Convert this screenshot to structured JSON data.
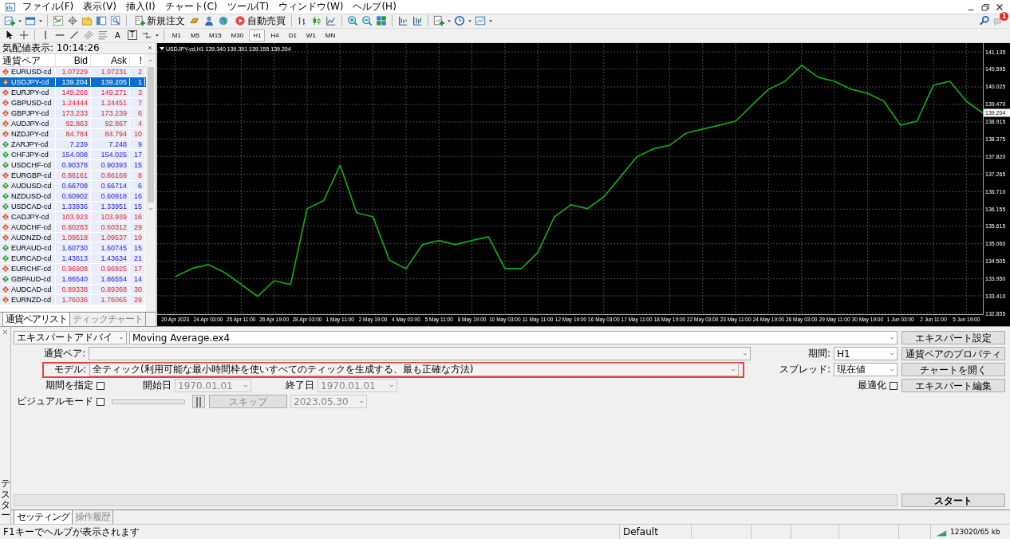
{
  "menu": [
    "ファイル(F)",
    "表示(V)",
    "挿入(I)",
    "チャート(C)",
    "ツール(T)",
    "ウィンドウ(W)",
    "ヘルプ(H)"
  ],
  "toolbar": {
    "buttons": [
      "新規注文",
      "自動売買"
    ],
    "drawing_tools": [
      "A",
      "T"
    ],
    "timeframes": [
      {
        "label": "M1",
        "selected": false
      },
      {
        "label": "M5",
        "selected": false
      },
      {
        "label": "M15",
        "selected": false
      },
      {
        "label": "M30",
        "selected": false
      },
      {
        "label": "H1",
        "selected": true
      },
      {
        "label": "H4",
        "selected": false
      },
      {
        "label": "D1",
        "selected": false
      },
      {
        "label": "W1",
        "selected": false
      },
      {
        "label": "MN",
        "selected": false
      }
    ],
    "notifications_badge": "1"
  },
  "market_watch": {
    "title": "気配値表示: 10:14:26",
    "columns": [
      "通貨ペア",
      "Bid",
      "Ask",
      "!"
    ],
    "rows": [
      {
        "symbol": "EURUSD-cd",
        "bid": "1.07229",
        "ask": "1.07231",
        "spread": "2",
        "down": true,
        "selected": false
      },
      {
        "symbol": "USDJPY-cd",
        "bid": "139.204",
        "ask": "139.205",
        "spread": "1",
        "down": true,
        "selected": true
      },
      {
        "symbol": "EURJPY-cd",
        "bid": "149.268",
        "ask": "149.271",
        "spread": "3",
        "down": true,
        "selected": false
      },
      {
        "symbol": "GBPUSD-cd",
        "bid": "1.24444",
        "ask": "1.24451",
        "spread": "7",
        "down": true,
        "selected": false
      },
      {
        "symbol": "GBPJPY-cd",
        "bid": "173.233",
        "ask": "173.239",
        "spread": "6",
        "down": true,
        "selected": false
      },
      {
        "symbol": "AUDJPY-cd",
        "bid": "92.863",
        "ask": "92.867",
        "spread": "4",
        "down": true,
        "selected": false
      },
      {
        "symbol": "NZDJPY-cd",
        "bid": "84.784",
        "ask": "84.794",
        "spread": "10",
        "down": true,
        "selected": false
      },
      {
        "symbol": "ZARJPY-cd",
        "bid": "7.239",
        "ask": "7.248",
        "spread": "9",
        "down": false,
        "selected": false
      },
      {
        "symbol": "CHFJPY-cd",
        "bid": "154.008",
        "ask": "154.025",
        "spread": "17",
        "down": false,
        "selected": false
      },
      {
        "symbol": "USDCHF-cd",
        "bid": "0.90378",
        "ask": "0.90393",
        "spread": "15",
        "down": false,
        "selected": false
      },
      {
        "symbol": "EURGBP-cd",
        "bid": "0.86161",
        "ask": "0.86169",
        "spread": "8",
        "down": true,
        "selected": false
      },
      {
        "symbol": "AUDUSD-cd",
        "bid": "0.66708",
        "ask": "0.66714",
        "spread": "6",
        "down": false,
        "selected": false
      },
      {
        "symbol": "NZDUSD-cd",
        "bid": "0.60902",
        "ask": "0.60918",
        "spread": "16",
        "down": false,
        "selected": false
      },
      {
        "symbol": "USDCAD-cd",
        "bid": "1.33936",
        "ask": "1.33951",
        "spread": "15",
        "down": false,
        "selected": false
      },
      {
        "symbol": "CADJPY-cd",
        "bid": "103.923",
        "ask": "103.939",
        "spread": "16",
        "down": true,
        "selected": false
      },
      {
        "symbol": "AUDCHF-cd",
        "bid": "0.60283",
        "ask": "0.60312",
        "spread": "29",
        "down": true,
        "selected": false
      },
      {
        "symbol": "AUDNZD-cd",
        "bid": "1.09518",
        "ask": "1.09537",
        "spread": "19",
        "down": true,
        "selected": false
      },
      {
        "symbol": "EURAUD-cd",
        "bid": "1.60730",
        "ask": "1.60745",
        "spread": "15",
        "down": false,
        "selected": false
      },
      {
        "symbol": "EURCAD-cd",
        "bid": "1.43613",
        "ask": "1.43634",
        "spread": "21",
        "down": false,
        "selected": false
      },
      {
        "symbol": "EURCHF-cd",
        "bid": "0.96908",
        "ask": "0.96925",
        "spread": "17",
        "down": true,
        "selected": false
      },
      {
        "symbol": "GBPAUD-cd",
        "bid": "1.86540",
        "ask": "1.86554",
        "spread": "14",
        "down": false,
        "selected": false
      },
      {
        "symbol": "AUDCAD-cd",
        "bid": "0.89338",
        "ask": "0.89368",
        "spread": "30",
        "down": true,
        "selected": false
      },
      {
        "symbol": "EURNZD-cd",
        "bid": "1.76036",
        "ask": "1.76065",
        "spread": "29",
        "down": true,
        "selected": false
      }
    ],
    "tabs": [
      {
        "label": "通貨ペアリスト",
        "selected": true
      },
      {
        "label": "ティックチャート",
        "selected": false
      }
    ]
  },
  "chart": {
    "header": "USDJPY-cd,H1  139.340 139.391 139.155 139.204",
    "price_marker": "139.204",
    "chart_data": {
      "type": "line",
      "categories": [
        "20 Apr 2023",
        null,
        "24 Apr 03:00",
        null,
        "25 Apr 11:00",
        null,
        "26 Apr 19:00",
        null,
        "28 Apr 03:00",
        null,
        "1 May 11:00",
        null,
        "2 May 19:00",
        null,
        "4 May 03:00",
        null,
        "5 May 11:00",
        null,
        "8 May 19:00",
        null,
        "10 May 03:00",
        null,
        "11 May 11:00",
        null,
        "12 May 19:00",
        null,
        "16 May 03:00",
        null,
        "17 May 11:00",
        null,
        "18 May 19:00",
        null,
        "22 May 03:00",
        null,
        "23 May 11:00",
        null,
        "24 May 19:00",
        null,
        "26 May 03:00",
        null,
        "29 May 11:00",
        null,
        "30 May 19:00",
        null,
        "1 Jun 03:00",
        null,
        "2 Jun 11:00",
        null,
        "5 Jun 19:00",
        null
      ],
      "grid": true,
      "series": [
        {
          "color": "#14a814",
          "values": [
            134.02,
            134.27,
            134.4,
            134.15,
            133.77,
            133.39,
            133.89,
            133.77,
            136.17,
            136.42,
            137.55,
            136.04,
            135.91,
            134.53,
            134.27,
            135.03,
            135.16,
            135.03,
            135.16,
            135.28,
            134.27,
            134.27,
            134.78,
            135.91,
            136.29,
            136.17,
            136.54,
            137.17,
            137.81,
            138.06,
            138.18,
            138.56,
            138.69,
            138.81,
            138.94,
            139.45,
            139.95,
            140.2,
            140.71,
            140.33,
            140.2,
            139.95,
            139.82,
            139.57,
            138.81,
            138.94,
            140.08,
            140.2,
            139.57,
            139.2
          ]
        }
      ],
      "ylim": [
        132.855,
        141.135
      ],
      "yticks": [
        {
          "value": 132.855,
          "label": "132.855"
        },
        {
          "value": 133.41,
          "label": "133.410"
        },
        {
          "value": 133.95,
          "label": "133.950"
        },
        {
          "value": 134.505,
          "label": "134.505"
        },
        {
          "value": 135.06,
          "label": "135.060"
        },
        {
          "value": 135.615,
          "label": "135.615"
        },
        {
          "value": 136.155,
          "label": "136.155"
        },
        {
          "value": 136.71,
          "label": "136.710"
        },
        {
          "value": 137.265,
          "label": "137.265"
        },
        {
          "value": 137.82,
          "label": "137.820"
        },
        {
          "value": 138.375,
          "label": "138.375"
        },
        {
          "value": 138.915,
          "label": "138.915"
        },
        {
          "value": 139.47,
          "label": "139.470"
        },
        {
          "value": 140.025,
          "label": "140.025"
        },
        {
          "value": 140.595,
          "label": "140.595"
        },
        {
          "value": 141.135,
          "label": "141.135"
        }
      ]
    }
  },
  "tester": {
    "title": "テスター",
    "type_select": "エキスパートアドバイ",
    "expert": "Moving Average.ex4",
    "symbol_label": "通貨ペア:",
    "model_label": "モデル:",
    "model": "全ティック(利用可能な最小時間枠を使いすべてのティックを生成する、最も正確な方法)",
    "model_highlighted": true,
    "period_label": "期間:",
    "period": "H1",
    "spread_label": "スプレッド:",
    "spread": "現在値",
    "use_date": {
      "label": "期間を指定",
      "checked": false
    },
    "from": {
      "label": "開始日",
      "value": "1970.01.01",
      "disabled": true
    },
    "to": {
      "label": "終了日",
      "value": "1970.01.01",
      "disabled": true
    },
    "optimization": {
      "label": "最適化",
      "checked": false
    },
    "visual_mode": {
      "label": "ビジュアルモード",
      "checked": false
    },
    "pause": "||",
    "skip": {
      "label": "スキップ",
      "disabled": true
    },
    "skip_to": {
      "value": "2023.05.30",
      "disabled": true
    },
    "buttons": [
      "エキスパート設定",
      "通貨ペアのプロパティ",
      "チャートを開く",
      "エキスパート編集"
    ],
    "progress": {
      "level": 0
    },
    "start": "スタート",
    "tabs": [
      {
        "label": "セッティング",
        "selected": true
      },
      {
        "label": "操作履歴",
        "selected": false
      }
    ]
  },
  "status_bar": {
    "help": "F1キーでヘルプが表示されます",
    "profile": "Default",
    "traffic": "123020/65 kb"
  }
}
